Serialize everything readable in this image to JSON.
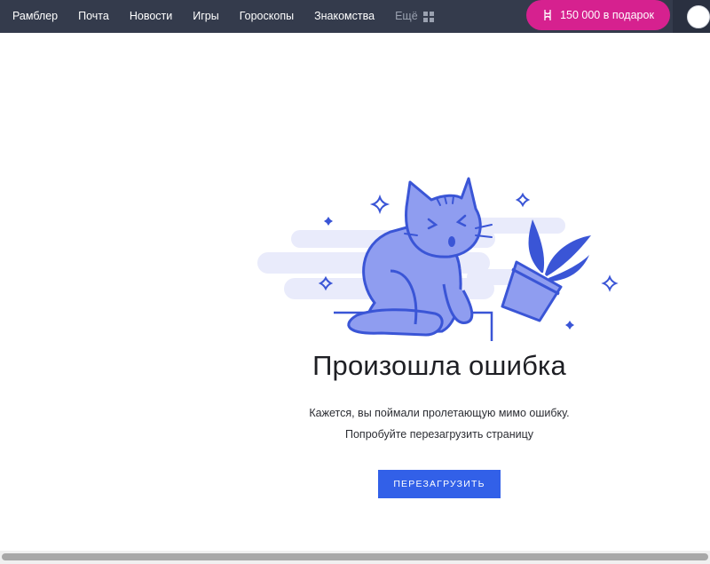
{
  "nav": {
    "items": [
      "Рамблер",
      "Почта",
      "Новости",
      "Игры",
      "Гороскопы",
      "Знакомства"
    ],
    "more_label": "Ещё"
  },
  "promo": {
    "label": "150 000 в подарок",
    "icon": "gift-icon",
    "color": "#d6218f"
  },
  "illustration": {
    "icon": "cat-with-fallen-plant-illustration"
  },
  "error": {
    "title": "Произошла ошибка",
    "line1": "Кажется, вы поймали пролетающую мимо ошибку.",
    "line2": "Попробуйте перезагрузить страницу"
  },
  "reload_button": {
    "label": "ПЕРЕЗАГРУЗИТЬ",
    "color": "#3260e8"
  },
  "colors": {
    "topbar": "#343b4c",
    "accent_blue": "#3260e8",
    "cat_fill": "#8f9df0"
  }
}
